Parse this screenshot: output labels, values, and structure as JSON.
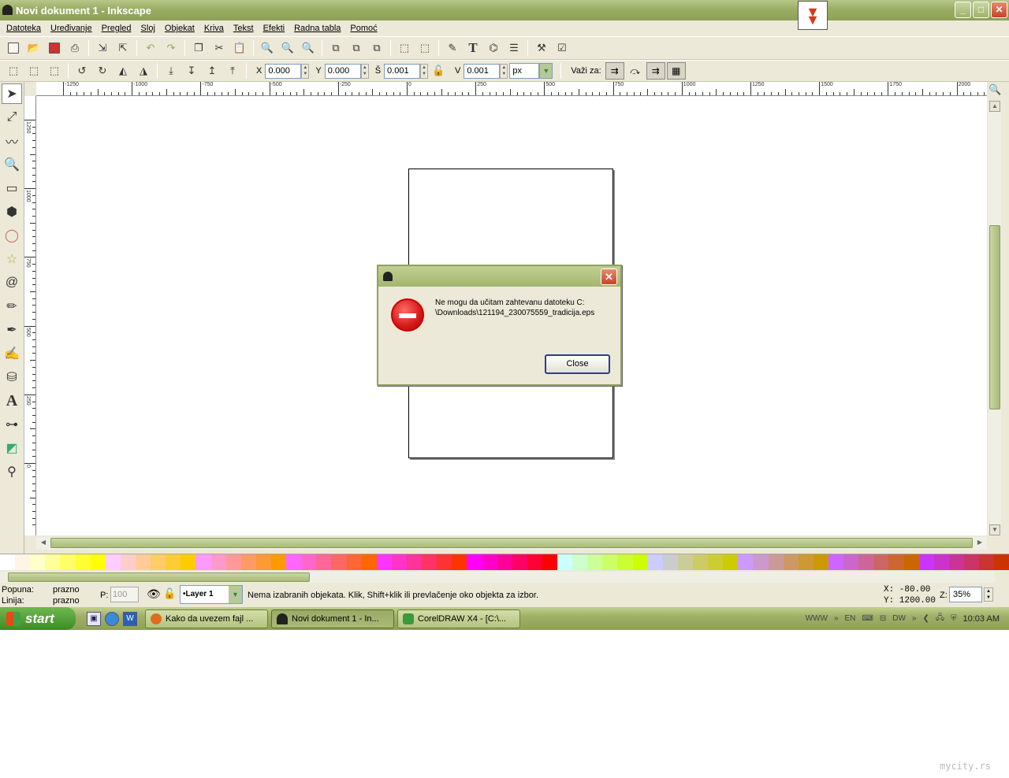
{
  "window": {
    "title": "Novi dokument 1 - Inkscape",
    "buttons": {
      "minimize": "_",
      "maximize": "□",
      "close": "✕"
    }
  },
  "menu": [
    "Datoteka",
    "Uređivanje",
    "Pregled",
    "Sloj",
    "Objekat",
    "Kriva",
    "Tekst",
    "Efekti",
    "Radna tabla",
    "Pomoć"
  ],
  "toolbar2": {
    "x_label": "X",
    "x_value": "0.000",
    "y_label": "Y",
    "y_value": "0.000",
    "w_label": "Š",
    "w_value": "0.001",
    "h_label": "V",
    "h_value": "0.001",
    "unit": "px",
    "applies_label": "Važi za:"
  },
  "ruler": {
    "h_labels": [
      "-1250",
      "-1000",
      "-750",
      "-500",
      "-250",
      "0",
      "250",
      "500",
      "750",
      "1000",
      "1250",
      "1500",
      "1750",
      "2000"
    ],
    "v_labels": [
      "1250",
      "1000",
      "750",
      "500",
      "250",
      "0"
    ]
  },
  "dialog": {
    "message_line1": "Ne mogu da učitam zahtevanu datoteku C:",
    "message_line2": "\\Downloads\\121194_230075559_tradicija.eps",
    "close_label": "Close"
  },
  "status": {
    "fill_label": "Popuna:",
    "fill_value": "prazno",
    "stroke_label": "Linija:",
    "stroke_value": "prazno",
    "opacity_label": "P:",
    "opacity_value": "100",
    "layer": "•Layer 1",
    "message": "Nema izabranih objekata. Klik, Shift+klik ili prevlačenje oko objekta za izbor.",
    "x_coord": "X:  -80.00",
    "y_coord": "Y: 1200.00",
    "zoom_label": "Z:",
    "zoom_value": "35%"
  },
  "taskbar": {
    "start_label": "start",
    "tasks": [
      "Kako da uvezem fajl ...",
      "Novi dokument 1 - In...",
      "CorelDRAW X4 - [C:\\..."
    ],
    "tray": {
      "www": "WWW",
      "lang": "EN",
      "dw": "DW",
      "clock": "10:03 AM"
    }
  },
  "watermark": "mycity.rs",
  "palette_colors": [
    "#ffffff",
    "#fff5e6",
    "#ffffcc",
    "#ffff99",
    "#ffff66",
    "#ffff33",
    "#ffff00",
    "#ffccff",
    "#ffcccc",
    "#ffcc99",
    "#ffcc66",
    "#ffcc33",
    "#ffcc00",
    "#ff99ff",
    "#ff99cc",
    "#ff9999",
    "#ff9966",
    "#ff9933",
    "#ff9900",
    "#ff66ff",
    "#ff66cc",
    "#ff6699",
    "#ff6666",
    "#ff6633",
    "#ff6600",
    "#ff33ff",
    "#ff33cc",
    "#ff3399",
    "#ff3366",
    "#ff3333",
    "#ff3300",
    "#ff00ff",
    "#ff00cc",
    "#ff0099",
    "#ff0066",
    "#ff0033",
    "#ff0000",
    "#ccffff",
    "#ccffcc",
    "#ccff99",
    "#ccff66",
    "#ccff33",
    "#ccff00",
    "#ccccff",
    "#cccccc",
    "#cccc99",
    "#cccc66",
    "#cccc33",
    "#cccc00",
    "#cc99ff",
    "#cc99cc",
    "#cc9999",
    "#cc9966",
    "#cc9933",
    "#cc9900",
    "#cc66ff",
    "#cc66cc",
    "#cc6699",
    "#cc6666",
    "#cc6633",
    "#cc6600",
    "#cc33ff",
    "#cc33cc",
    "#cc3399",
    "#cc3366",
    "#cc3333",
    "#cc3300"
  ]
}
